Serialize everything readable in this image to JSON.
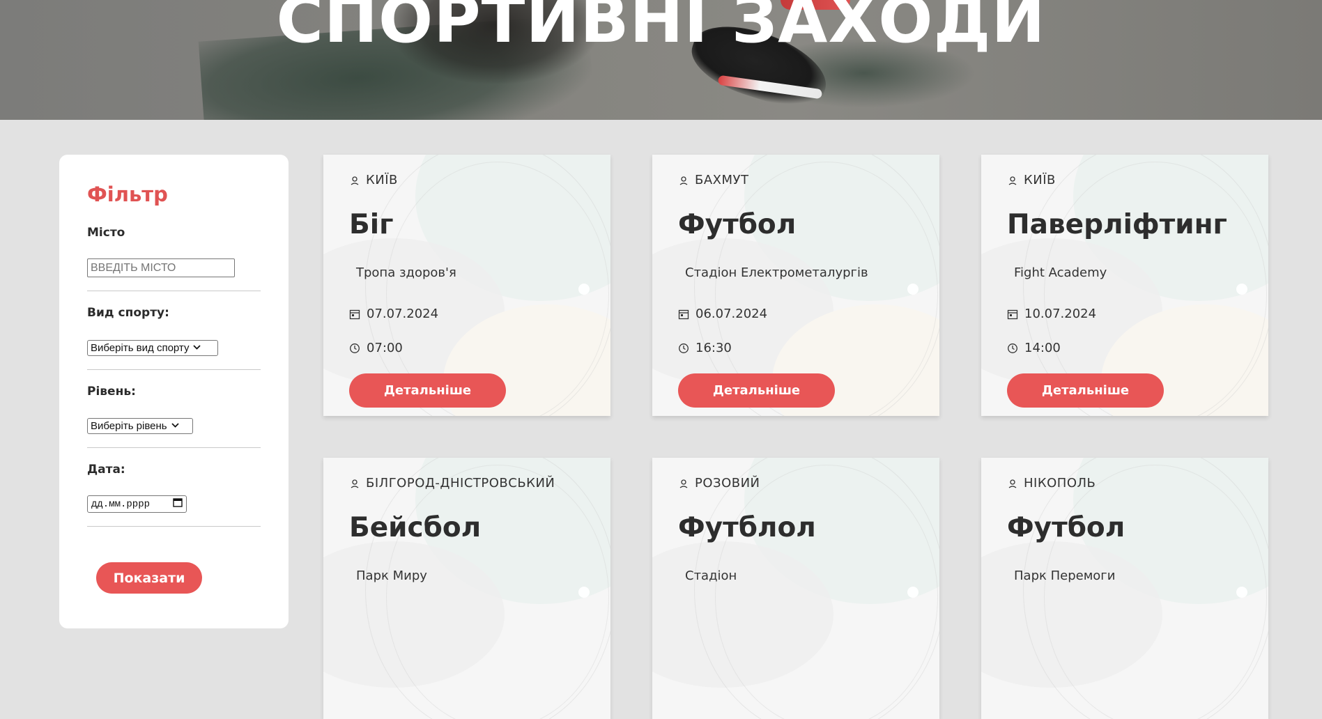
{
  "hero": {
    "title": "СПОРТИВНІ ЗАХОДИ"
  },
  "filter": {
    "title": "Фільтр",
    "city_label": "Місто",
    "city_placeholder": "ВВЕДІТЬ МІСТО",
    "sport_label": "Вид спорту:",
    "sport_selected": "Виберіть вид спорту",
    "level_label": "Рівень:",
    "level_selected": "Виберіть рівень",
    "date_label": "Дата:",
    "date_placeholder": "дд.мм.рррр",
    "submit_label": "Показати"
  },
  "colors": {
    "accent": "#e85656",
    "page_bg": "#e2e2e2",
    "text_dark": "#2d2d2d"
  },
  "cards": [
    {
      "city": "КИЇВ",
      "title": "Біг",
      "place": "Тропа здоров'я",
      "date": "07.07.2024",
      "time": "07:00",
      "button": "Детальніше"
    },
    {
      "city": "БАХМУТ",
      "title": "Футбол",
      "place": "Стадіон Електрометалургів",
      "date": "06.07.2024",
      "time": "16:30",
      "button": "Детальніше"
    },
    {
      "city": "КИЇВ",
      "title": "Паверліфтинг",
      "place": "Fight Academy",
      "date": "10.07.2024",
      "time": "14:00",
      "button": "Детальніше"
    },
    {
      "city": "БІЛГОРОД-ДНІСТРОВСЬКИЙ",
      "title": "Бейсбол",
      "place": "Парк Миру"
    },
    {
      "city": "РОЗОВИЙ",
      "title": "Футблол",
      "place": "Стадіон"
    },
    {
      "city": "НІКОПОЛЬ",
      "title": "Футбол",
      "place": "Парк Перемоги"
    }
  ],
  "icons": {
    "city": "location-pin-icon",
    "date": "calendar-icon",
    "time": "clock-icon",
    "select": "chevron-down-icon",
    "date_picker": "calendar-icon"
  }
}
